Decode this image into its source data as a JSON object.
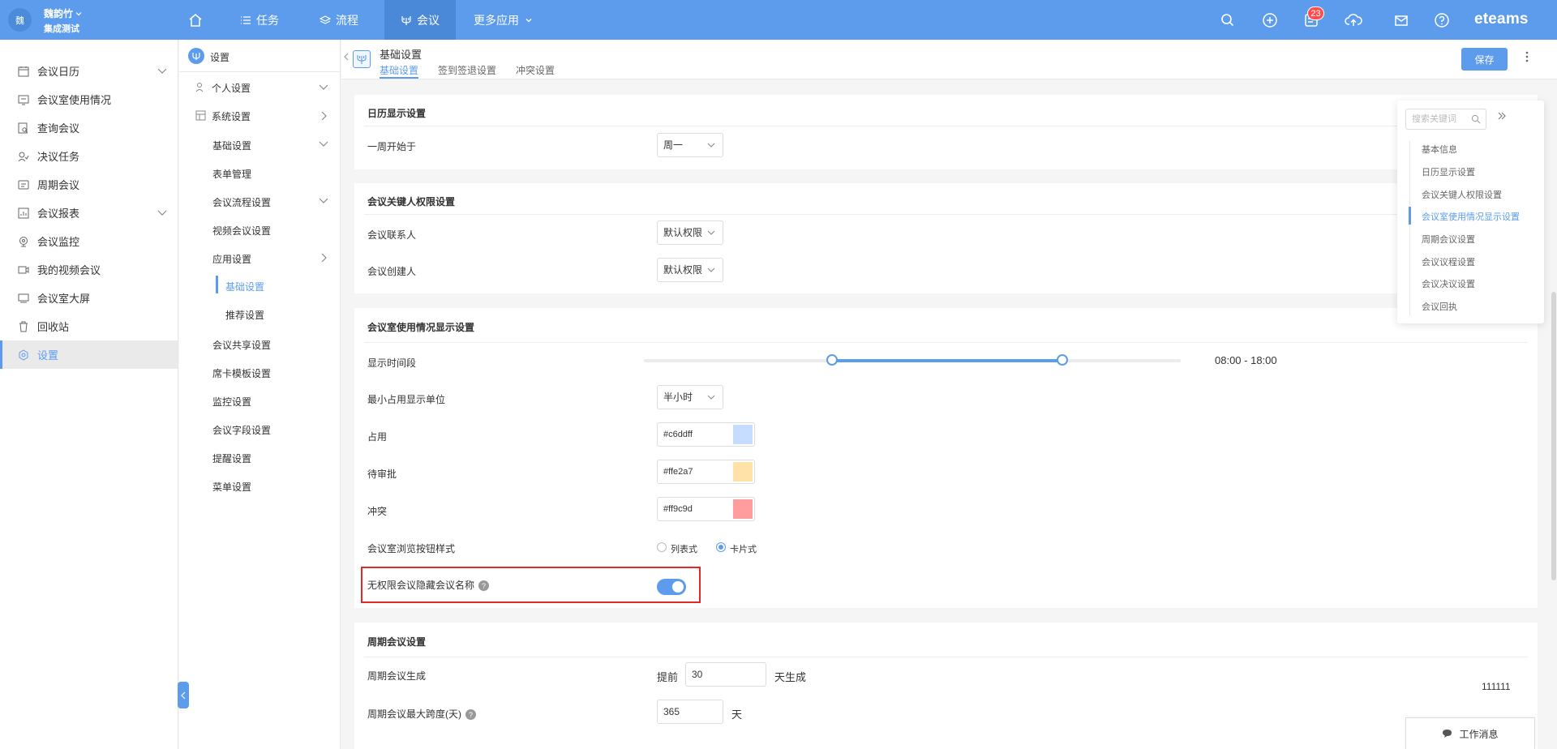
{
  "topbar": {
    "avatar_text": "魏",
    "user_name": "魏韵竹",
    "org_name": "集成测试",
    "nav": [
      {
        "label": "任务",
        "icon": "list-icon"
      },
      {
        "label": "流程",
        "icon": "layers-icon"
      },
      {
        "label": "会议",
        "icon": "meeting-icon"
      },
      {
        "label": "更多应用",
        "icon": "chevron-down-icon"
      }
    ],
    "notification_count": "23",
    "brand": "eteams"
  },
  "sidebar": {
    "items": [
      {
        "label": "会议日历",
        "icon": "calendar-icon"
      },
      {
        "label": "会议室使用情况",
        "icon": "room-usage-icon"
      },
      {
        "label": "查询会议",
        "icon": "search-doc-icon"
      },
      {
        "label": "决议任务",
        "icon": "task-icon"
      },
      {
        "label": "周期会议",
        "icon": "cycle-icon"
      },
      {
        "label": "会议报表",
        "icon": "report-icon"
      },
      {
        "label": "会议监控",
        "icon": "monitor-icon"
      },
      {
        "label": "我的视频会议",
        "icon": "video-icon"
      },
      {
        "label": "会议室大屏",
        "icon": "screen-icon"
      },
      {
        "label": "回收站",
        "icon": "trash-icon"
      },
      {
        "label": "设置",
        "icon": "settings-icon"
      }
    ]
  },
  "sidebar2": {
    "title": "设置",
    "items": [
      "个人设置",
      "系统设置",
      "基础设置",
      "表单管理",
      "会议流程设置",
      "视频会议设置",
      "应用设置",
      "基础设置",
      "推荐设置",
      "会议共享设置",
      "席卡模板设置",
      "监控设置",
      "会议字段设置",
      "提醒设置",
      "菜单设置"
    ]
  },
  "header": {
    "title": "基础设置",
    "tabs": [
      "基础设置",
      "签到签退设置",
      "冲突设置"
    ],
    "save_label": "保存"
  },
  "calendar_section": {
    "title": "日历显示设置",
    "week_start_label": "一周开始于",
    "week_start_value": "周一"
  },
  "permission_section": {
    "title": "会议关键人权限设置",
    "contact_label": "会议联系人",
    "contact_value": "默认权限",
    "creator_label": "会议创建人",
    "creator_value": "默认权限"
  },
  "room_section": {
    "title": "会议室使用情况显示设置",
    "time_label": "显示时间段",
    "time_value": "08:00 - 18:00",
    "slider_range": [
      0.35,
      0.78
    ],
    "min_unit_label": "最小占用显示单位",
    "min_unit_value": "半小时",
    "occupied_label": "占用",
    "occupied_color": "#c6ddff",
    "pending_label": "待审批",
    "pending_color": "#ffe2a7",
    "conflict_label": "冲突",
    "conflict_color": "#ff9c9d",
    "style_label": "会议室浏览按钮样式",
    "style_options": [
      "列表式",
      "卡片式"
    ],
    "style_selected": "卡片式",
    "hide_name_label": "无权限会议隐藏会议名称",
    "hide_name_on": true
  },
  "periodic_section": {
    "title": "周期会议设置",
    "gen_label": "周期会议生成",
    "gen_prefix": "提前",
    "gen_value": "30",
    "gen_suffix": "天生成",
    "max_label": "周期会议最大跨度(天)",
    "max_value": "365",
    "max_suffix": "天"
  },
  "anchor_panel": {
    "search_placeholder": "搜索关键词",
    "items": [
      "基本信息",
      "日历显示设置",
      "会议关键人权限设置",
      "会议室使用情况显示设置",
      "周期会议设置",
      "会议议程设置",
      "会议决议设置",
      "会议回执"
    ],
    "active_index": 3
  },
  "side_number": "111111",
  "message_button": "工作消息"
}
